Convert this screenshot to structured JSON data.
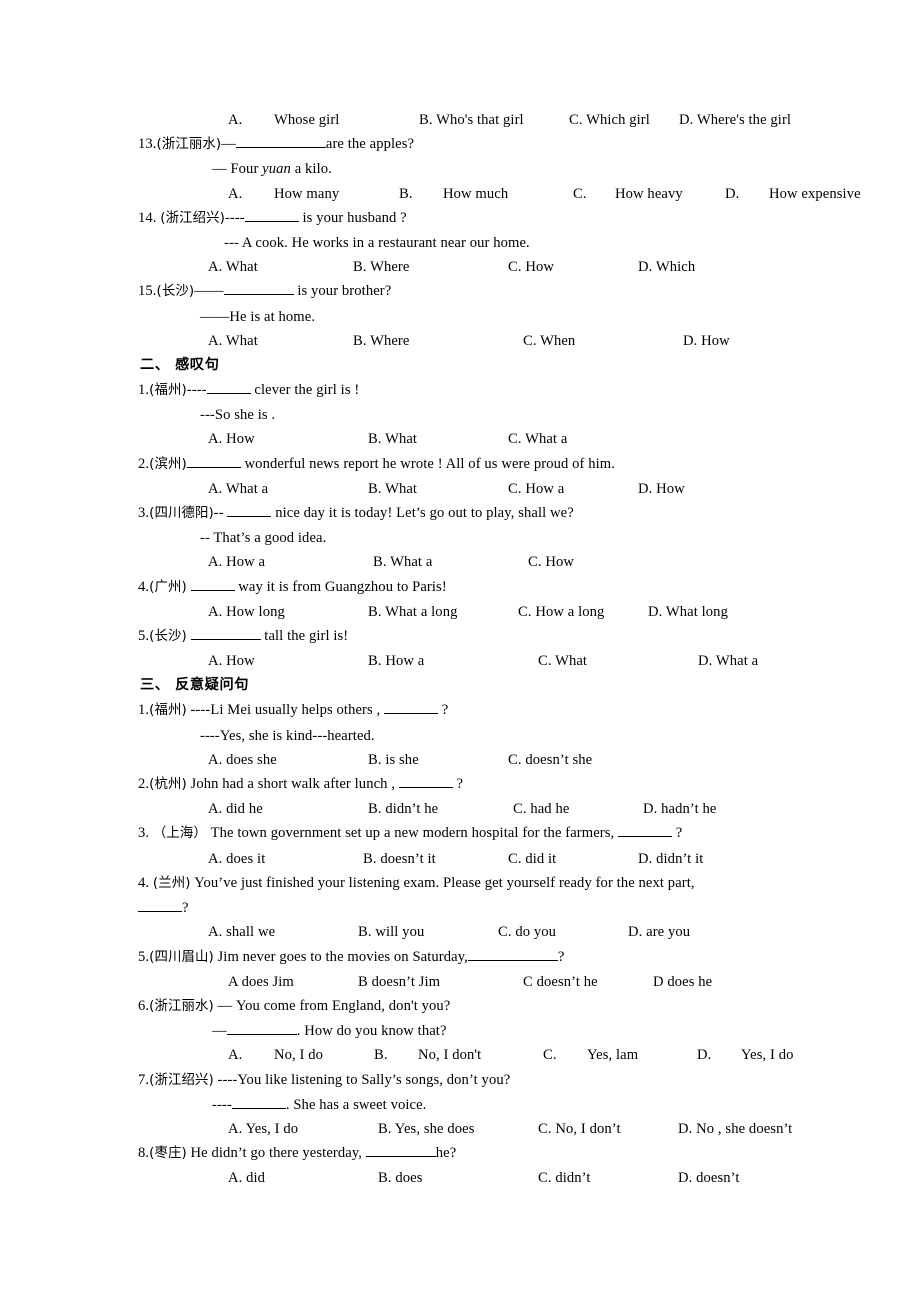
{
  "document": {
    "type": "english-grammar-worksheet",
    "page_background": "#ffffff",
    "text_color": "#000000"
  },
  "section_one_tail": {
    "q12_options": {
      "a_label": "A.",
      "a_text": "Whose girl",
      "b_text": "B. Who's that girl",
      "c_text": "C. Which girl",
      "d_text": "D. Where's the girl"
    },
    "q13": {
      "number": "13.",
      "source": "(浙江丽水)",
      "stem_pre": "—",
      "stem_post": "are the apples?",
      "answer_pre": "— Four ",
      "answer_italic": "yuan",
      "answer_post": " a kilo.",
      "options": {
        "a_label": "A.",
        "a_text": "How many",
        "b_label": "B.",
        "b_text": "How much",
        "c_label": "C.",
        "c_text": "How heavy",
        "d_label": "D.",
        "d_text": "How expensive"
      }
    },
    "q14": {
      "number": "14.",
      "source": "(浙江绍兴)",
      "stem_pre": "----",
      "stem_post": " is your husband ?",
      "answer": "--- A cook. He works in a restaurant near our home.",
      "options": {
        "a": "A. What",
        "b": "B. Where",
        "c": "C. How",
        "d": "D. Which"
      }
    },
    "q15": {
      "number": "15.",
      "source": "(长沙)",
      "stem_dash": "——",
      "stem_post": " is your brother?",
      "answer": "——He is at home.",
      "options": {
        "a": "A. What",
        "b": "B. Where",
        "c": "C. When",
        "d": "D. How"
      }
    }
  },
  "section_two": {
    "heading": "二、 感叹句",
    "questions": [
      {
        "number": "1.",
        "source": "(福州)",
        "stem_pre": "----",
        "stem_post": " clever the girl is !",
        "answer": "---So she is .",
        "options": {
          "a": "A. How",
          "b": "B. What",
          "c": "C. What a",
          "d": ""
        }
      },
      {
        "number": "2.",
        "source": "(滨州)",
        "stem_pre": "",
        "stem_post": " wonderful news report he wrote ! All of us were proud of him.",
        "answer": "",
        "options": {
          "a": "A. What a",
          "b": "B. What",
          "c": "C. How a",
          "d": "D. How"
        }
      },
      {
        "number": "3.",
        "source": "(四川德阳)",
        "stem_pre": "-- ",
        "stem_post": " nice day it is today! Let’s go out to play, shall we?",
        "answer": "-- That’s a good idea.",
        "options": {
          "a": "A. How a",
          "b": "B. What a",
          "c": "C. How",
          "d": ""
        }
      },
      {
        "number": "4.",
        "source": "(广州)",
        "stem_pre": "",
        "stem_post": " way it is from Guangzhou to Paris!",
        "answer": "",
        "options": {
          "a": "A. How long",
          "b": "B. What a long",
          "c": "C. How a long",
          "d": "D. What long"
        }
      },
      {
        "number": "5.",
        "source": "(长沙)",
        "stem_pre": "",
        "stem_post": " tall the girl is!",
        "answer": "",
        "options": {
          "a": "A. How",
          "b": "B. How a",
          "c": "C. What",
          "d": "D. What a"
        }
      }
    ]
  },
  "section_three": {
    "heading": "三、 反意疑问句",
    "questions": [
      {
        "number": "1.",
        "source": "(福州)",
        "stem_pre": " ----Li Mei usually helps others , ",
        "stem_post": " ?",
        "answer": "----Yes, she is kind---hearted.",
        "options": {
          "a": "A. does she",
          "b": "B. is she",
          "c": "C. doesn’t she",
          "d": ""
        }
      },
      {
        "number": "2.",
        "source": "(杭州)",
        "stem_pre": " John had a short walk after lunch , ",
        "stem_post": " ?",
        "answer": "",
        "options": {
          "a": "A. did he",
          "b": "B. didn’t he",
          "c": "C. had he",
          "d": "D. hadn’t he"
        }
      },
      {
        "number": "3.",
        "source": "（上海）",
        "stem_pre": " The town government set up a new modern hospital for the farmers, ",
        "stem_post": " ?",
        "answer": "",
        "options": {
          "a": "A. does it",
          "b": "B. doesn’t it",
          "c": "C. did it",
          "d": "D. didn’t it"
        }
      },
      {
        "number": "4.",
        "source": "(兰州)",
        "stem_pre": " You’ve just finished your listening exam. Please get yourself ready for the next part,",
        "stem_post": "?",
        "answer": "",
        "options": {
          "a": "A. shall we",
          "b": "B. will you",
          "c": "C. do you",
          "d": "D. are you"
        }
      },
      {
        "number": "5.",
        "source": "(四川眉山)",
        "stem_pre": " Jim never goes to the movies on Saturday,",
        "stem_post": "?",
        "answer": "",
        "options": {
          "a": "A does Jim",
          "b": "B  doesn’t Jim",
          "c": "C doesn’t he",
          "d": "D   does he"
        }
      },
      {
        "number": "6.",
        "source": "(浙江丽水)",
        "stem_pre": " — You come from England, don't you?",
        "stem_post": "",
        "answer_pre": "—",
        "answer_post": ". How do you know that?",
        "options": {
          "a_label": "A.",
          "a": "No, I do",
          "b_label": "B.",
          "b": "No, I don't",
          "c_label": "C.",
          "c": "Yes, lam",
          "d_label": "D.",
          "d": "Yes, I do"
        }
      },
      {
        "number": "7.",
        "source": "(浙江绍兴)",
        "stem_pre": " ----You like listening to Sally’s songs, don’t you?",
        "stem_post": "",
        "answer_pre": "----",
        "answer_post": ". She has a sweet voice.",
        "options": {
          "a": "A. Yes, I do",
          "b": "B. Yes, she does",
          "c": "C. No, I don’t",
          "d": "D. No , she doesn’t"
        }
      },
      {
        "number": "8.",
        "source": "(枣庄)",
        "stem_pre": " He didn’t go there yesterday, ",
        "stem_post": "he?",
        "answer": "",
        "options": {
          "a": "A. did",
          "b": "B. does",
          "c": "C. didn’t",
          "d": "D. doesn’t"
        }
      }
    ]
  }
}
